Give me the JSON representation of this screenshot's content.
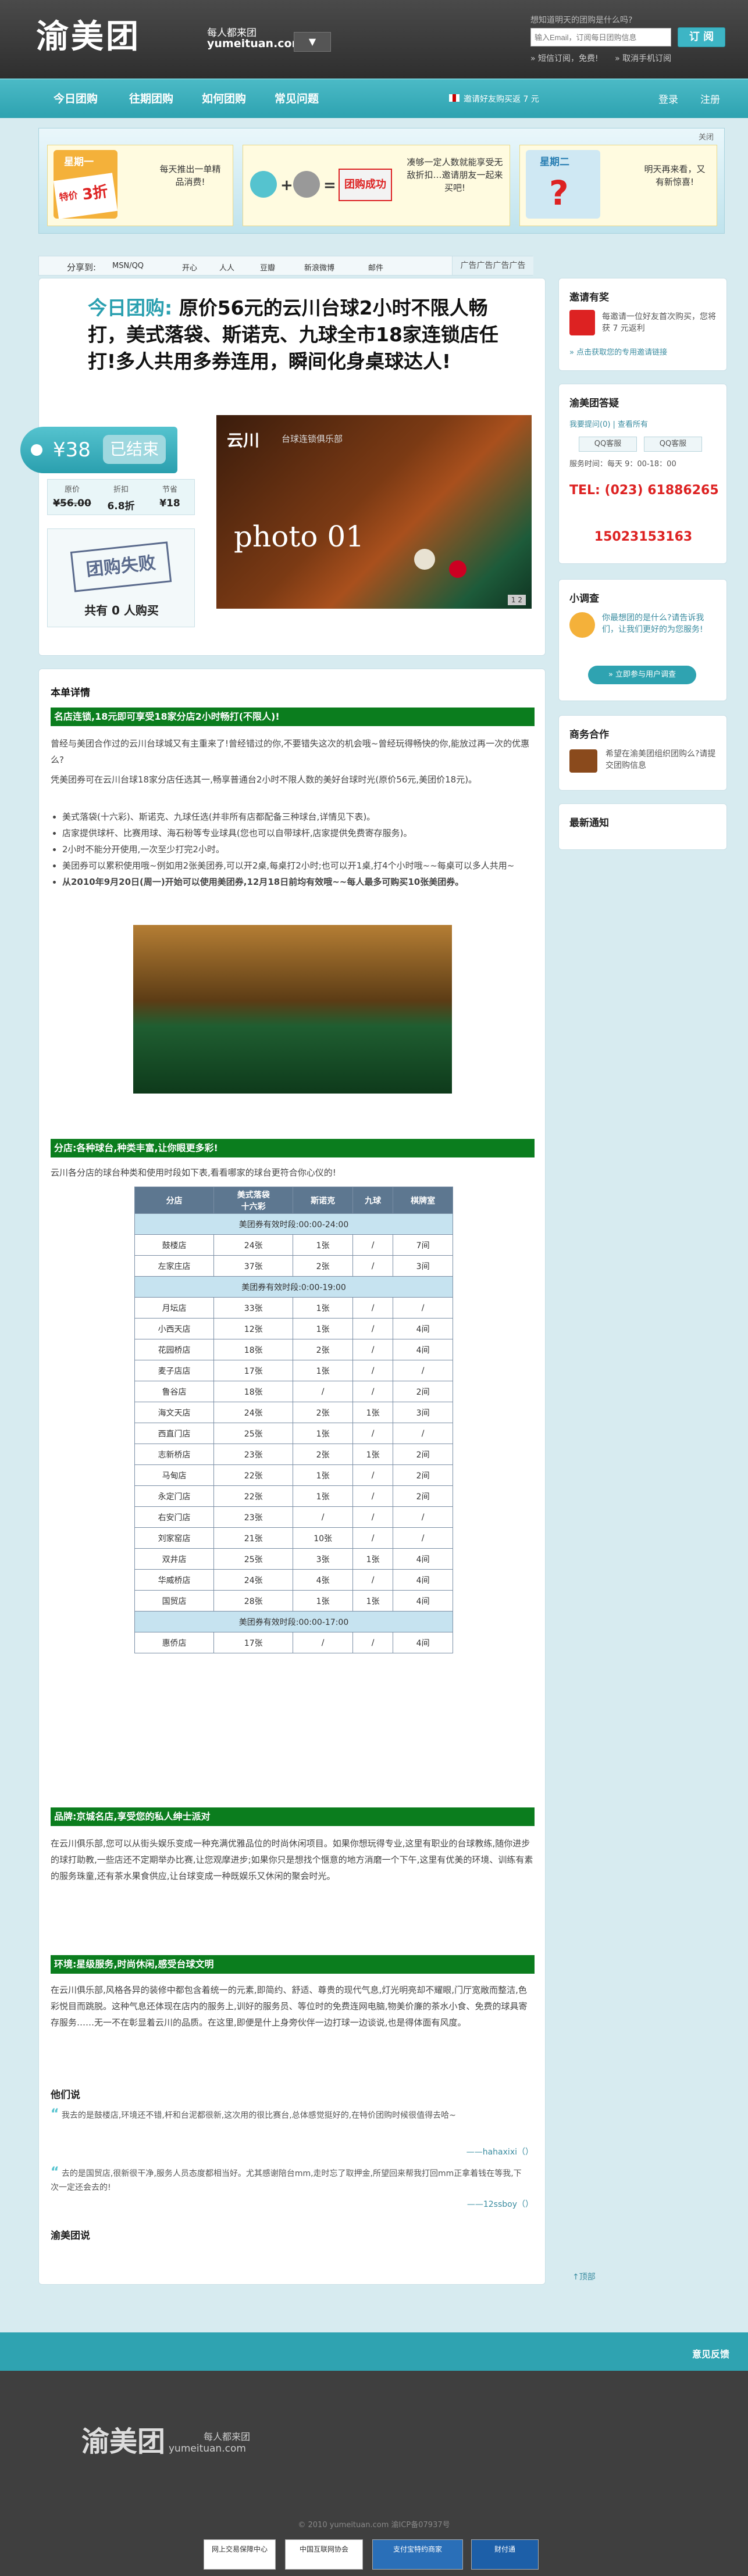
{
  "header": {
    "logo": "渝美团",
    "slogan": "每人都来团",
    "domain": "yumeituan.com",
    "city_button": "▼",
    "subscribe_tip": "想知道明天的团购是什么吗?",
    "email_placeholder": "输入Email，订阅每日团购信息",
    "subscribe_label": "订 阅",
    "sms_subscribe": "» 短信订阅，免费!",
    "sms_cancel": "» 取消手机订阅"
  },
  "nav": {
    "items": [
      "今日团购",
      "往期团购",
      "如何团购",
      "常见问题"
    ],
    "invite": "邀请好友购买返 7 元",
    "login": "登录",
    "register": "注册"
  },
  "promo": {
    "close": "关闭",
    "box1_tag": "星期一",
    "box1_sale": "特价",
    "box1_discount": "3折",
    "box1_text": "每天推出一单精品消费!",
    "box2_text": "凑够一定人数就能享受无敌折扣…邀请朋友一起来买吧!",
    "box2_success": "团购成功",
    "box3_tag": "星期二",
    "box3_text": "明天再来看，又有新惊喜!"
  },
  "share": {
    "label": "分享到:",
    "items": [
      "MSN/QQ",
      "开心",
      "人人",
      "豆瓣",
      "新浪微博",
      "邮件"
    ],
    "ad": "广告广告广告广告"
  },
  "deal": {
    "today": "今日团购:",
    "title": "原价56元的云川台球2小时不限人畅打，美式落袋、斯诺克、九球全市18家连锁店任打!多人共用多券连用，瞬间化身桌球达人!",
    "price": "¥38",
    "ended": "已结束",
    "stats": [
      {
        "label": "原价",
        "value": "¥56.00"
      },
      {
        "label": "折扣",
        "value": "6.8折"
      },
      {
        "label": "节省",
        "value": "¥18"
      }
    ],
    "fail_stamp": "团购失败",
    "fail_count": "共有 0 人购买",
    "photo_logo": "云川",
    "photo_sub": "台球连锁俱乐部",
    "photo_caption": "photo 01",
    "photo_pager": "1  2"
  },
  "detail": {
    "title": "本单详情",
    "sec1": "名店连锁,18元即可享受18家分店2小时畅打(不限人)!",
    "para1": "曾经与美团合作过的云川台球城又有主重来了!曾经错过的你,不要错失这次的机会哦~曾经玩得畅快的你,能放过再一次的优惠么?",
    "para2": "凭美团券可在云川台球18家分店任选其一,畅享普通台2小时不限人数的美好台球时光(原价56元,美团价18元)。",
    "bullets": [
      "美式落袋(十六彩)、斯诺克、九球任选(并非所有店都配备三种球台,详情见下表)。",
      "店家提供球杆、比赛用球、海石粉等专业球具(您也可以自带球杆,店家提供免费寄存服务)。",
      "2小时不能分开使用,一次至少打完2小时。",
      "美团券可以累积使用哦~例如用2张美团券,可以开2桌,每桌打2小时;也可以开1桌,打4个小时哦~~每桌可以多人共用~",
      "从2010年9月20日(周一)开始可以使用美团券,12月18日前均有效哦~~每人最多可购买10张美团券。"
    ],
    "sec2": "分店:各种球台,种类丰富,让你眼更多彩!",
    "para3": "云川各分店的球台种类和使用时段如下表,看看哪家的球台更符合你心仪的!",
    "table": {
      "headers": [
        "分店",
        "美式落袋\n十六彩",
        "斯诺克",
        "九球",
        "棋牌室"
      ],
      "groups": [
        {
          "label": "美团券有效时段:00:00-24:00",
          "rows": [
            [
              "鼓楼店",
              "24张",
              "1张",
              "/",
              "7间"
            ],
            [
              "左家庄店",
              "37张",
              "2张",
              "/",
              "3间"
            ]
          ]
        },
        {
          "label": "美团券有效时段:0:00-19:00",
          "rows": [
            [
              "月坛店",
              "33张",
              "1张",
              "/",
              "/"
            ],
            [
              "小西天店",
              "12张",
              "1张",
              "/",
              "4间"
            ],
            [
              "花园桥店",
              "18张",
              "2张",
              "/",
              "4间"
            ],
            [
              "麦子店店",
              "17张",
              "1张",
              "/",
              "/"
            ],
            [
              "鲁谷店",
              "18张",
              "/",
              "/",
              "2间"
            ],
            [
              "海文天店",
              "24张",
              "2张",
              "1张",
              "3间"
            ],
            [
              "西直门店",
              "25张",
              "1张",
              "/",
              "/"
            ],
            [
              "志新桥店",
              "23张",
              "2张",
              "1张",
              "2间"
            ],
            [
              "马甸店",
              "22张",
              "1张",
              "/",
              "2间"
            ],
            [
              "永定门店",
              "22张",
              "1张",
              "/",
              "2间"
            ],
            [
              "右安门店",
              "23张",
              "/",
              "/",
              "/"
            ],
            [
              "刘家窑店",
              "21张",
              "10张",
              "/",
              "/"
            ],
            [
              "双井店",
              "25张",
              "3张",
              "1张",
              "4间"
            ],
            [
              "华威桥店",
              "24张",
              "4张",
              "/",
              "4间"
            ],
            [
              "国贸店",
              "28张",
              "1张",
              "1张",
              "4间"
            ]
          ]
        },
        {
          "label": "美团券有效时段:00:00-17:00",
          "rows": [
            [
              "惠侨店",
              "17张",
              "/",
              "/",
              "4间"
            ]
          ]
        }
      ]
    },
    "sec3": "品牌:京城名店,享受您的私人绅士派对",
    "para4": "在云川俱乐部,您可以从街头娱乐变成一种充满优雅品位的时尚休闲项目。如果你想玩得专业,这里有职业的台球教练,随你进步的球打助教,一些店还不定期举办比赛,让您观摩进步;如果你只是想找个惬意的地方消磨一个下午,这里有优美的环境、训练有素的服务珠童,还有茶水果食供应,让台球变成一种既娱乐又休闲的聚会时光。",
    "sec4": "环境:星级服务,时尚休闲,感受台球文明",
    "para5": "在云川俱乐部,风格各异的装修中都包含着统一的元素,即简约、舒适、尊贵的现代气息,灯光明亮却不耀眼,门厅宽敞而整洁,色彩悦目而跳脱。这种气息还体现在店内的服务上,训好的服务员、等位时的免费连网电脑,物美价廉的茶水小食、免费的球具寄存服务……无一不在彰显着云川的品质。在这里,即便是什上身旁伙伴一边打球一边谈说,也是得体面有风度。",
    "reviews_title": "他们说",
    "reviews": [
      {
        "text": "我去的是鼓楼店,环境还不错,杆和台泥都很新,这次用的很比赛台,总体感觉挺好的,在特价团购时候很值得去哈~",
        "author": "——hahaxixi（）"
      },
      {
        "text": "去的是国贸店,很新很干净,服务人员态度都相当好。尤其感谢陪台mm,走时忘了取押金,所望回来帮我打回mm正拿着钱在等我,下次一定还会去的!",
        "author": "——12ssboy（）"
      }
    ],
    "team": "渝美团说",
    "back_top": "↑顶部"
  },
  "sidebar": {
    "invite_title": "邀请有奖",
    "invite_text": "每邀请一位好友首次购买，您将获 7 元返利",
    "invite_link": "» 点击获取您的专用邀请链接",
    "answer_title": "渝美团答疑",
    "answer_links": "我要提问(0)  |  查看所有",
    "qq1": "QQ客服",
    "qq2": "QQ客服",
    "hours": "服务时间：每天 9：00-18：00",
    "tel": "TEL: (023) 61886265",
    "mobile": "15023153163",
    "survey_title": "小调查",
    "survey_text": "你最想团的是什么?请告诉我们，让我们更好的为您服务!",
    "survey_button": "» 立即参与用户调查",
    "biz_title": "商务合作",
    "biz_text": "希望在渝美团组织团购么?请提交团购信息",
    "notice_title": "最新通知"
  },
  "footer": {
    "feedback": "意见反馈",
    "logo": "渝美团",
    "slogan": "每人都来团",
    "domain": "yumeituan.com",
    "copyright": "© 2010 yumeituan.com  渝ICP备07937号",
    "badges": [
      "网上交易保障中心",
      "中国互联网协会",
      "支付宝特约商家",
      "财付通"
    ]
  }
}
